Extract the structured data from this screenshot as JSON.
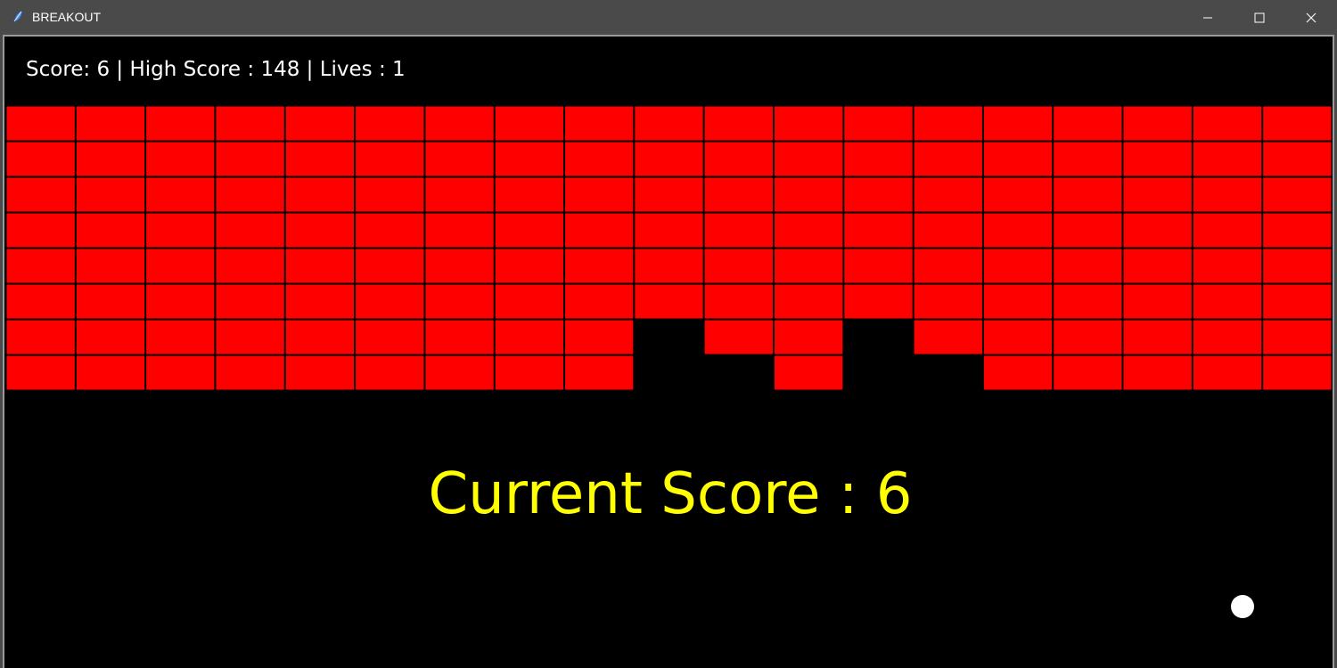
{
  "window": {
    "title": "BREAKOUT",
    "icon": "feather-icon",
    "controls": [
      "minimize-icon",
      "maximize-icon",
      "close-icon"
    ]
  },
  "hud": {
    "score_label": "Score:",
    "score": 6,
    "high_score_label": "High Score :",
    "high_score": 148,
    "lives_label": "Lives :",
    "lives": 1,
    "text": "Score: 6 | High Score : 148 | Lives : 1"
  },
  "banner": {
    "text": "Current Score : 6"
  },
  "bricks": {
    "color": "#ff0000",
    "background": "#000000",
    "columns": 19,
    "rows": 8,
    "grid": [
      [
        1,
        1,
        1,
        1,
        1,
        1,
        1,
        1,
        1,
        1,
        1,
        1,
        1,
        1,
        1,
        1,
        1,
        1,
        1
      ],
      [
        1,
        1,
        1,
        1,
        1,
        1,
        1,
        1,
        1,
        1,
        1,
        1,
        1,
        1,
        1,
        1,
        1,
        1,
        1
      ],
      [
        1,
        1,
        1,
        1,
        1,
        1,
        1,
        1,
        1,
        1,
        1,
        1,
        1,
        1,
        1,
        1,
        1,
        1,
        1
      ],
      [
        1,
        1,
        1,
        1,
        1,
        1,
        1,
        1,
        1,
        1,
        1,
        1,
        1,
        1,
        1,
        1,
        1,
        1,
        1
      ],
      [
        1,
        1,
        1,
        1,
        1,
        1,
        1,
        1,
        1,
        1,
        1,
        1,
        1,
        1,
        1,
        1,
        1,
        1,
        1
      ],
      [
        1,
        1,
        1,
        1,
        1,
        1,
        1,
        1,
        1,
        1,
        1,
        1,
        1,
        1,
        1,
        1,
        1,
        1,
        1
      ],
      [
        1,
        1,
        1,
        1,
        1,
        1,
        1,
        1,
        1,
        0,
        1,
        1,
        0,
        1,
        1,
        1,
        1,
        1,
        1
      ],
      [
        1,
        1,
        1,
        1,
        1,
        1,
        1,
        1,
        1,
        0,
        0,
        1,
        0,
        0,
        1,
        1,
        1,
        1,
        1
      ]
    ]
  },
  "colors": {
    "hud_text": "#ffffff",
    "banner_text": "#ffff00",
    "ball": "#ffffff",
    "titlebar": "#4a4a4a"
  }
}
